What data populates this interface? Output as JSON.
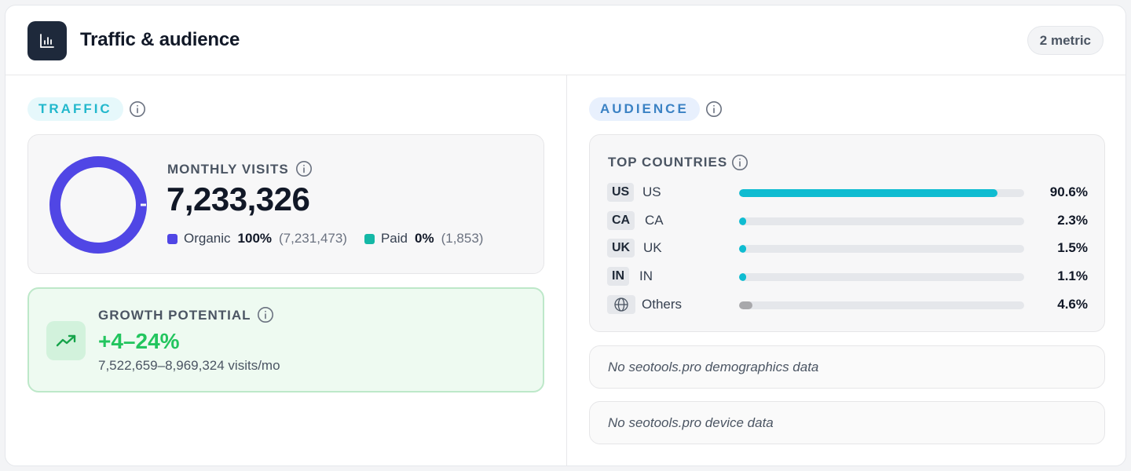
{
  "header": {
    "title": "Traffic & audience",
    "metric_badge": "2 metric",
    "icon": "bar-chart-icon"
  },
  "traffic": {
    "section_label": "TRAFFIC",
    "monthly_visits": {
      "label": "MONTHLY VISITS",
      "value": "7,233,326",
      "organic": {
        "label": "Organic",
        "pct": "100%",
        "count": "(7,231,473)",
        "color": "#5046e5",
        "fraction": 0.9997
      },
      "paid": {
        "label": "Paid",
        "pct": "0%",
        "count": "(1,853)",
        "color": "#14b8a6",
        "fraction": 0.0003
      }
    },
    "growth": {
      "label": "GROWTH POTENTIAL",
      "value": "+4–24%",
      "range": "7,522,659–8,969,324 visits/mo",
      "icon": "trending-up-icon",
      "color": "#22c55e"
    }
  },
  "audience": {
    "section_label": "AUDIENCE",
    "top_countries": {
      "label": "TOP COUNTRIES",
      "rows": [
        {
          "code": "US",
          "name": "US",
          "pct": "90.6%",
          "fill": 0.906,
          "color": "#0fbcd1"
        },
        {
          "code": "CA",
          "name": "CA",
          "pct": "2.3%",
          "fill": 0.023,
          "color": "#0fbcd1"
        },
        {
          "code": "UK",
          "name": "UK",
          "pct": "1.5%",
          "fill": 0.015,
          "color": "#0fbcd1"
        },
        {
          "code": "IN",
          "name": "IN",
          "pct": "1.1%",
          "fill": 0.011,
          "color": "#0fbcd1"
        },
        {
          "code": "",
          "name": "Others",
          "pct": "4.6%",
          "fill": 0.046,
          "color": "#a8a8ab",
          "icon": "globe-icon"
        }
      ]
    },
    "demographics_empty": "No seotools.pro demographics data",
    "device_empty": "No seotools.pro device data"
  }
}
